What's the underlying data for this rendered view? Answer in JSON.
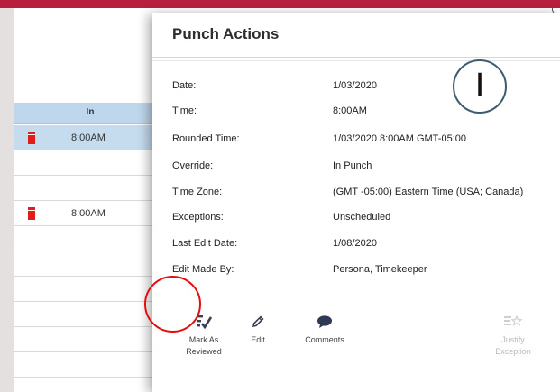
{
  "background_grid": {
    "column_header_in": "In",
    "rows": [
      {
        "has_exception": true,
        "in_time": "8:00AM",
        "selected": true
      },
      {
        "has_exception": false,
        "in_time": "",
        "selected": false
      },
      {
        "has_exception": true,
        "in_time": "8:00AM",
        "selected": false
      }
    ]
  },
  "modal": {
    "title": "Punch Actions",
    "details": [
      {
        "label": "Date:",
        "value": "1/03/2020"
      },
      {
        "label": "Time:",
        "value": "8:00AM"
      },
      {
        "label": "Rounded Time:",
        "value": "1/03/2020 8:00AM GMT-05:00"
      },
      {
        "label": "Override:",
        "value": "In Punch"
      },
      {
        "label": "Time Zone:",
        "value": "(GMT -05:00) Eastern Time (USA; Canada)"
      },
      {
        "label": "Exceptions:",
        "value": "Unscheduled"
      },
      {
        "label": "Last Edit Date:",
        "value": "1/08/2020"
      },
      {
        "label": "Edit Made By:",
        "value": "Persona, Timekeeper"
      }
    ],
    "actions": [
      {
        "id": "mark-as-reviewed",
        "label_line1": "Mark As",
        "label_line2": "Reviewed",
        "icon": "checklist-icon",
        "enabled": true
      },
      {
        "id": "edit",
        "label_line1": "Edit",
        "label_line2": "",
        "icon": "pencil-icon",
        "enabled": true
      },
      {
        "id": "comments",
        "label_line1": "Comments",
        "label_line2": "",
        "icon": "speech-bubble-icon",
        "enabled": true
      },
      {
        "id": "justify-exception",
        "label_line1": "Justify",
        "label_line2": "Exception",
        "icon": "justify-star-icon",
        "enabled": false
      }
    ]
  },
  "annotations": {
    "marker_letter": "I",
    "highlight_color": "#e30e0e"
  },
  "colors": {
    "brand_bar": "#b81f3e",
    "selected_row": "#c5dbee",
    "exception_flag": "#e21b1b"
  }
}
